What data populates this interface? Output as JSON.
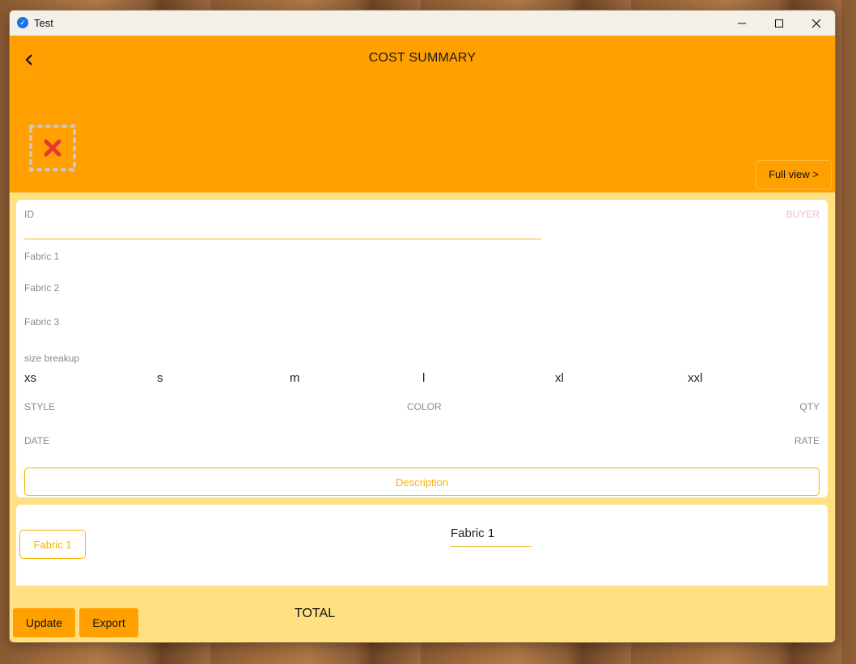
{
  "window": {
    "title": "Test"
  },
  "header": {
    "title": "COST SUMMARY",
    "full_view_label": "Full view >"
  },
  "form": {
    "id_label": "ID",
    "buyer_label": "BUYER",
    "fabric1_label": "Fabric 1",
    "fabric2_label": "Fabric 2",
    "fabric3_label": "Fabric 3",
    "size_breakup_label": "size breakup",
    "sizes": [
      "xs",
      "s",
      "m",
      "l",
      "xl",
      "xxl"
    ],
    "style_label": "STYLE",
    "color_label": "COLOR",
    "qty_label": "QTY",
    "date_label": "DATE",
    "rate_label": "RATE",
    "description_label": "Description"
  },
  "fabric_panel": {
    "chip_label": "Fabric 1",
    "selected_value": "Fabric 1"
  },
  "footer": {
    "update_label": "Update",
    "export_label": "Export",
    "total_label": "TOTAL"
  },
  "colors": {
    "accent": "#ffa000",
    "background": "#ffe082",
    "outline": "#f5b400",
    "buyer_label": "#f6b8d2"
  },
  "icons": [
    "app-icon",
    "minimize-icon",
    "maximize-icon",
    "close-icon",
    "back-arrow-icon",
    "broken-image-icon"
  ]
}
